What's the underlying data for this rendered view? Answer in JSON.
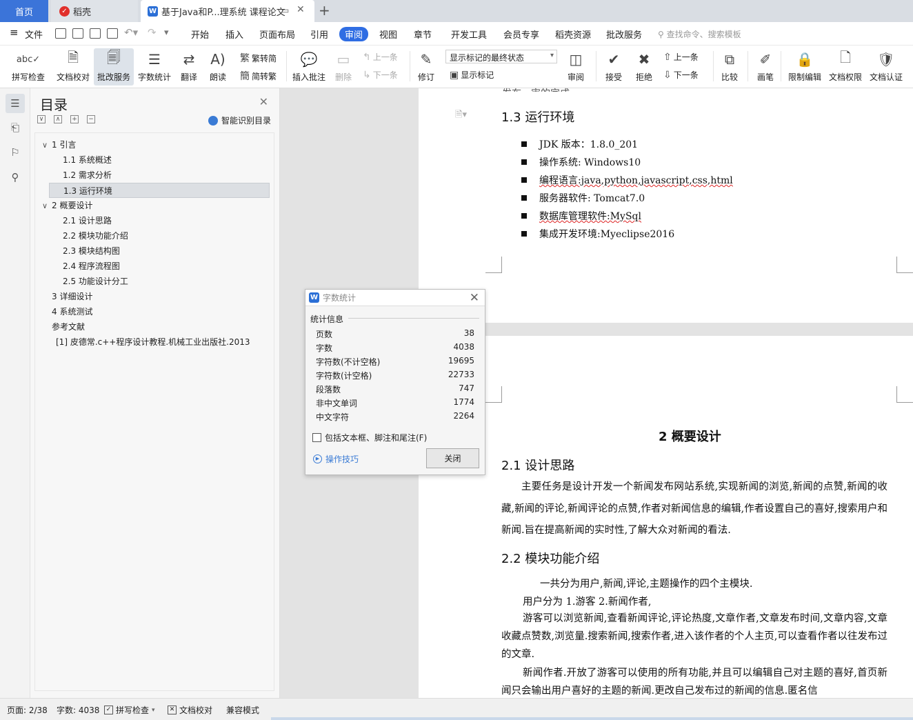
{
  "tabs": {
    "home": "首页",
    "daoke": "稻壳",
    "doc": "基于Java和P...理系统 课程论文",
    "new_tab": "+"
  },
  "menubar": {
    "file": "文件",
    "items": [
      "开始",
      "插入",
      "页面布局",
      "引用",
      "审阅",
      "视图",
      "章节",
      "开发工具",
      "会员专享",
      "稻壳资源",
      "批改服务"
    ],
    "active": "审阅",
    "search_placeholder": "查找命令、搜索模板"
  },
  "toolbar": {
    "spell_check": "拼写检查",
    "doc_proof": "文档校对",
    "review_service": "批改服务",
    "word_count": "字数统计",
    "translate": "翻译",
    "read_aloud": "朗读",
    "to_traditional": "繁转简",
    "to_simplified": "简转繁",
    "insert_comment": "插入批注",
    "delete": "删除",
    "prev": "上一条",
    "next": "下一条",
    "track_changes": "修订",
    "markup_select": "显示标记的最终状态",
    "show_markup": "显示标记",
    "review": "审阅",
    "accept": "接受",
    "reject": "拒绝",
    "prev2": "上一条",
    "next2": "下一条",
    "compare": "比较",
    "pen": "画笔",
    "restrict_edit": "限制编辑",
    "doc_permission": "文档权限",
    "doc_cert": "文档认证"
  },
  "toc": {
    "title": "目录",
    "smart": "智能识别目录",
    "items": [
      {
        "label": "1  引言",
        "level": 1,
        "arrow": "∨"
      },
      {
        "label": "1.1  系统概述",
        "level": 2
      },
      {
        "label": "1.2  需求分析",
        "level": 2
      },
      {
        "label": "1.3  运行环境",
        "level": 2,
        "selected": true
      },
      {
        "label": "2  概要设计",
        "level": 1,
        "arrow": "∨"
      },
      {
        "label": "2.1  设计思路",
        "level": 2
      },
      {
        "label": "2.2  模块功能介绍",
        "level": 2
      },
      {
        "label": "2.3  模块结构图",
        "level": 2
      },
      {
        "label": "2.4  程序流程图",
        "level": 2
      },
      {
        "label": "2.5  功能设计分工",
        "level": 2
      },
      {
        "label": "3    详细设计",
        "level": 1
      },
      {
        "label": "4  系统测试",
        "level": 1
      },
      {
        "label": "参考文献",
        "level": 1
      },
      {
        "label": "[1]  皮德常.c++程序设计教程.机械工业出版社.2013",
        "level": 3
      }
    ]
  },
  "document": {
    "top_cut": "发布、审的完成。",
    "h13": "1.3  运行环境",
    "env": [
      "JDK 版本：1.8.0_201",
      "操作系统: Windows10",
      "编程语言:java,python,javascript,css,html",
      "服务器软件: Tomcat7.0",
      "数据库管理软件:MySql",
      "集成开发环境:Myeclipse2016"
    ],
    "h2": "2  概要设计",
    "h21": "2.1  设计思路",
    "p21": "主要任务是设计开发一个新闻发布网站系统,实现新闻的浏览,新闻的点赞,新闻的收藏,新闻的评论,新闻评论的点赞,作者对新闻信息的编辑,作者设置自己的喜好,搜索用户和新闻.旨在提高新闻的实时性,了解大众对新闻的看法.",
    "h22": "2.2  模块功能介绍",
    "p22a": "一共分为用户,新闻,评论,主题操作的四个主模块.",
    "p22b": "用户分为 1.游客 2.新闻作者,",
    "p22c": "游客可以浏览新闻,查看新闻评论,评论热度,文章作者,文章发布时间,文章内容,文章收藏点赞数,浏览量.搜索新闻,搜索作者,进入该作者的个人主页,可以查看作者以往发布过的文章.",
    "p22d": "新闻作者.开放了游客可以使用的所有功能,并且可以编辑自己对主题的喜好,首页新闻只会输出用户喜好的主题的新闻.更改自己发布过的新闻的信息.匿名信"
  },
  "dialog": {
    "title": "字数统计",
    "group": "统计信息",
    "rows": [
      {
        "label": "页数",
        "value": "38"
      },
      {
        "label": "字数",
        "value": "4038"
      },
      {
        "label": "字符数(不计空格)",
        "value": "19695"
      },
      {
        "label": "字符数(计空格)",
        "value": "22733"
      },
      {
        "label": "段落数",
        "value": "747"
      },
      {
        "label": "非中文单词",
        "value": "1774"
      },
      {
        "label": "中文字符",
        "value": "2264"
      }
    ],
    "checkbox": "包括文本框、脚注和尾注(F)",
    "tips": "操作技巧",
    "close": "关闭"
  },
  "status": {
    "page": "页面: 2/38",
    "words": "字数: 4038",
    "spell": "拼写检查",
    "proof": "文档校对",
    "compat": "兼容模式"
  },
  "colors": {
    "accent": "#2f6de3",
    "home_tab": "#3b74d9",
    "link": "#3a7bd5"
  }
}
